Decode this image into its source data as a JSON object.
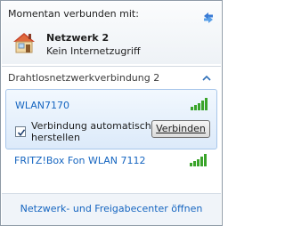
{
  "header": {
    "title": "Momentan verbunden mit:",
    "network_name": "Netzwerk  2",
    "network_status": "Kein Internetzugriff"
  },
  "section": {
    "title": "Drahtlosnetzwerkverbindung 2"
  },
  "networks": [
    {
      "name": "WLAN7170",
      "signal_bars": 5,
      "selected": true,
      "auto_connect_label": "Verbindung automatisch herstellen",
      "auto_connect_checked": true,
      "connect_label": "Verbinden"
    },
    {
      "name": "FRITZ!Box Fon WLAN 7112",
      "signal_bars": 5,
      "selected": false
    }
  ],
  "footer": {
    "link_label": "Netzwerk- und Freigabecenter öffnen"
  },
  "colors": {
    "link": "#1565c0",
    "signal": "#3aa42a",
    "selection": "#dceafa"
  },
  "icons": [
    "refresh-icon",
    "home-network-icon",
    "collapse-chevron-icon",
    "signal-strength-icon",
    "checkmark-icon"
  ]
}
